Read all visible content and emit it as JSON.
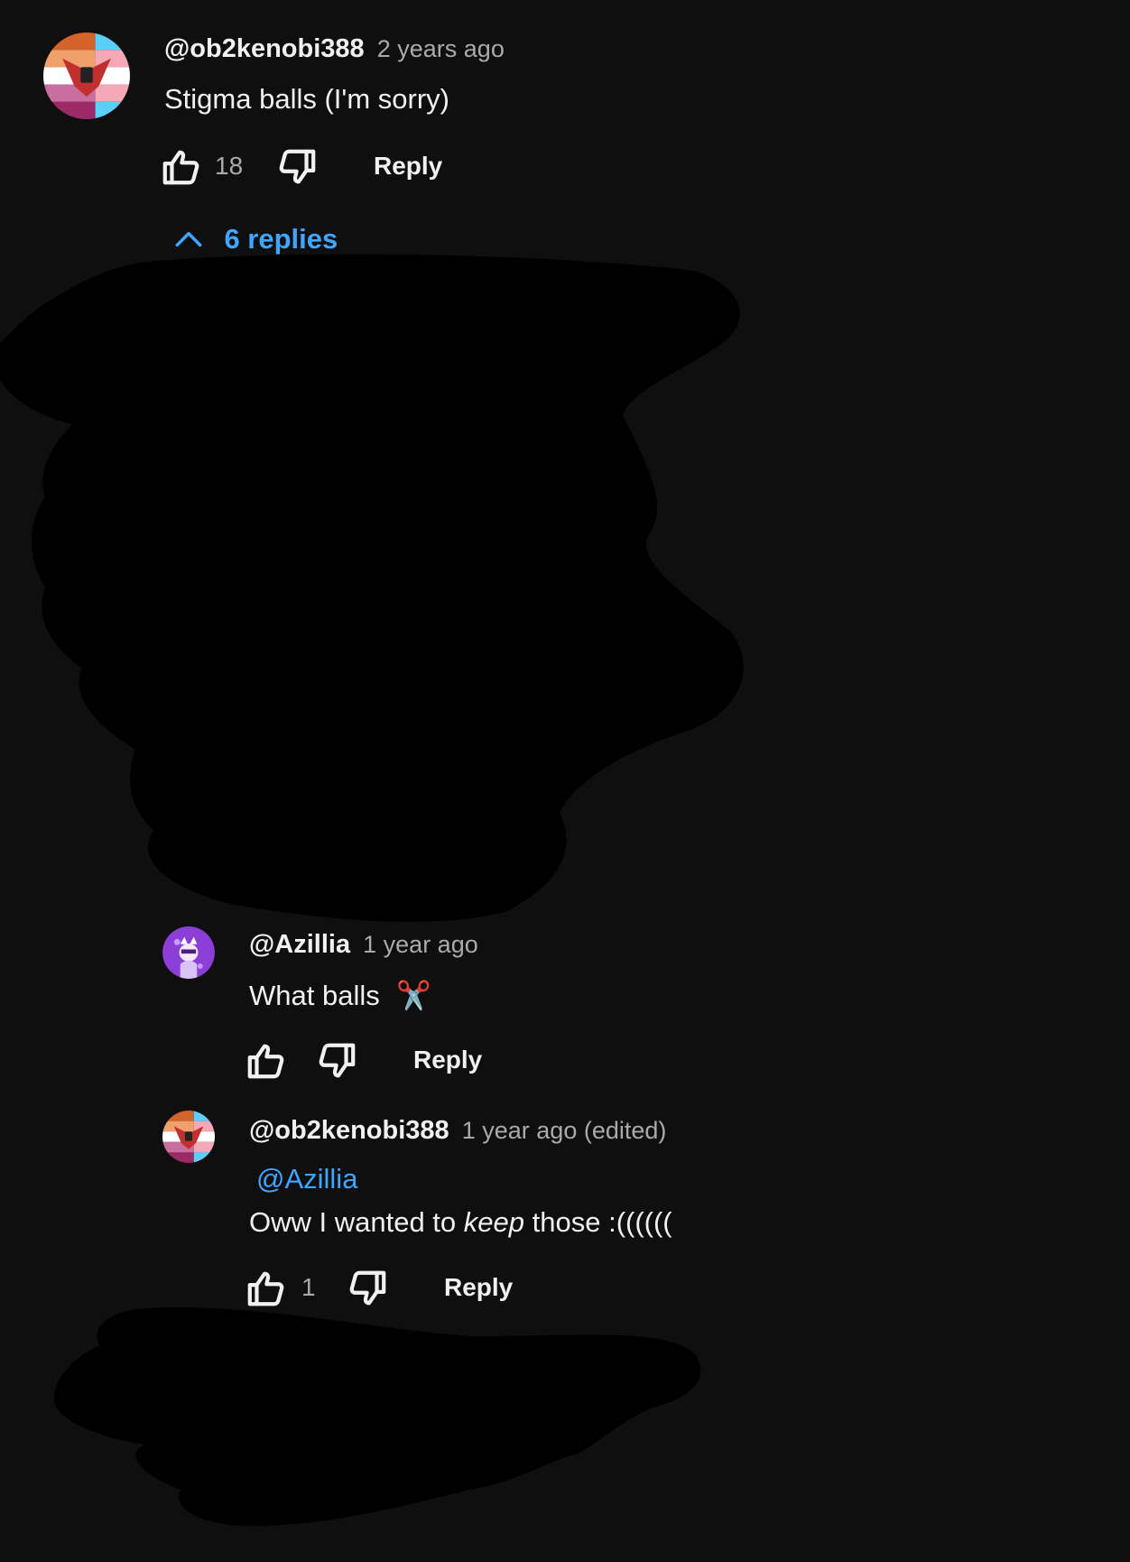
{
  "top_comment": {
    "handle": "@ob2kenobi388",
    "time": "2 years ago",
    "text": "Stigma balls (I'm sorry)",
    "likes": "18",
    "reply_label": "Reply",
    "replies_toggle": "6 replies",
    "avatar_icon": "flag-avatar"
  },
  "replies": [
    {
      "handle": "@Azillia",
      "time": "1 year ago",
      "text": "What balls",
      "emoji": "✂️",
      "likes": "",
      "reply_label": "Reply",
      "avatar_icon": "purple-character-avatar"
    },
    {
      "handle": "@ob2kenobi388",
      "time": "1 year ago (edited)",
      "mention": "@Azillia",
      "text_before": "Oww I wanted to ",
      "text_italic": "keep",
      "text_after": " those :((((((",
      "likes": "1",
      "reply_label": "Reply",
      "avatar_icon": "flag-avatar"
    }
  ],
  "colors": {
    "background": "#0f0f0f",
    "link": "#3ea6ff",
    "muted": "#aaaaaa",
    "text": "#f1f1f1",
    "redaction": "#000000"
  }
}
